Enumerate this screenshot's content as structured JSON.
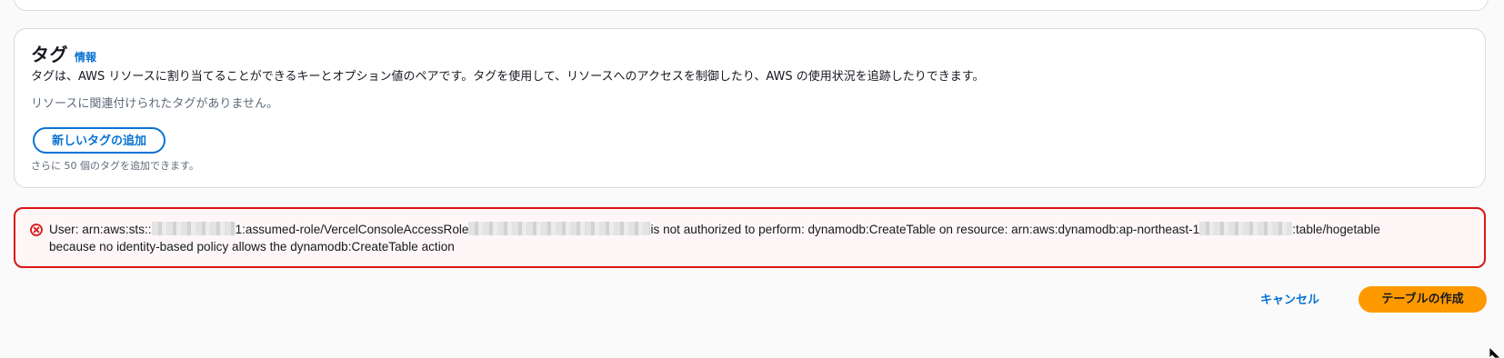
{
  "tags_section": {
    "title": "タグ",
    "info_link": "情報",
    "description": "タグは、AWS リソースに割り当てることができるキーとオプション値のペアです。タグを使用して、リソースへのアクセスを制御したり、AWS の使用状況を追跡したりできます。",
    "empty_message": "リソースに関連付けられたタグがありません。",
    "add_button": "新しいタグの追加",
    "limit_hint": "さらに 50 個のタグを追加できます。"
  },
  "error": {
    "icon": "error-circle-x-icon",
    "part1": "User: arn:aws:sts::",
    "part2": "1:assumed-role/VercelConsoleAccessRole",
    "part3": "is not authorized to perform: dynamodb:CreateTable on resource: arn:aws:dynamodb:ap-northeast-1",
    "part4": ":table/hogetable",
    "part5": "because no identity-based policy allows the dynamodb:CreateTable action"
  },
  "footer": {
    "cancel_label": "キャンセル",
    "create_label": "テーブルの作成"
  },
  "colors": {
    "accent_link": "#0972d3",
    "primary_button": "#ff9900",
    "error_border": "#d91515",
    "error_background": "#fff7f7"
  }
}
